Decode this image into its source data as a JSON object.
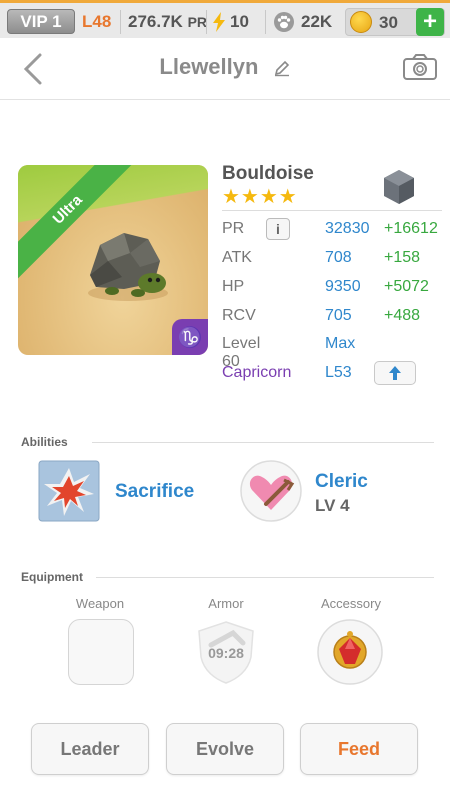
{
  "status": {
    "vip": "VIP 1",
    "level": "L48",
    "power": "276.7K",
    "power_unit": "PR",
    "energy": "10",
    "food": "22K",
    "coins": "30",
    "add": "+"
  },
  "header": {
    "title": "Llewellyn"
  },
  "monster": {
    "rarity": "Ultra",
    "sign_glyph": "♑",
    "name": "Bouldoise",
    "stars": "★★★★",
    "stats": [
      {
        "label": "PR",
        "value": "32830",
        "bonus": "+16612"
      },
      {
        "label": "ATK",
        "value": "708",
        "bonus": "+158"
      },
      {
        "label": "HP",
        "value": "9350",
        "bonus": "+5072"
      },
      {
        "label": "RCV",
        "value": "705",
        "bonus": "+488"
      }
    ],
    "level_label": "Level 60",
    "level_value": "Max",
    "sign_label": "Capricorn",
    "sign_level": "L53",
    "info": "i"
  },
  "abilities": {
    "title": "Abilities",
    "items": [
      {
        "name": "Sacrifice"
      },
      {
        "name": "Cleric",
        "sub": "LV 4"
      }
    ]
  },
  "equipment": {
    "title": "Equipment",
    "weapon": "Weapon",
    "armor": "Armor",
    "armor_timer": "09:28",
    "accessory": "Accessory"
  },
  "buttons": {
    "leader": "Leader",
    "evolve": "Evolve",
    "feed": "Feed"
  },
  "colors": {
    "accent_blue": "#2f87cc",
    "bonus_green": "#38a83f",
    "feed_orange": "#e8772e",
    "capricorn_purple": "#7a3eb1"
  }
}
